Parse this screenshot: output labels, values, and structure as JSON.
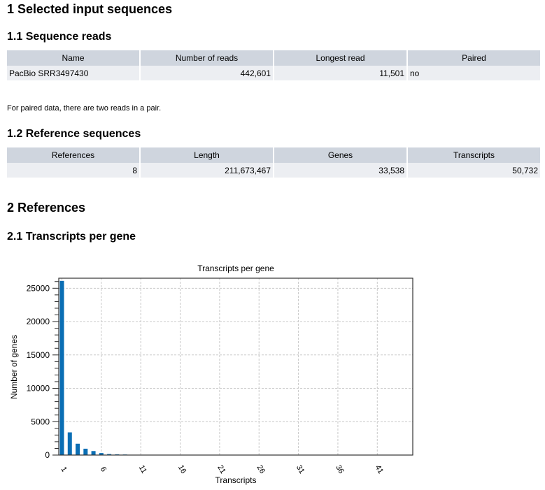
{
  "sections": {
    "s1_title": "1 Selected input sequences",
    "s1_1_title": "1.1 Sequence reads",
    "s1_note": "For paired data, there are two reads in a pair.",
    "s1_2_title": "1.2 Reference sequences",
    "s2_title": "2 References",
    "s2_1_title": "2.1 Transcripts per gene"
  },
  "reads_table": {
    "headers": [
      "Name",
      "Number of reads",
      "Longest read",
      "Paired"
    ],
    "rows": [
      [
        "PacBio SRR3497430",
        "442,601",
        "11,501",
        "no"
      ]
    ]
  },
  "ref_table": {
    "headers": [
      "References",
      "Length",
      "Genes",
      "Transcripts"
    ],
    "rows": [
      [
        "8",
        "211,673,467",
        "33,538",
        "50,732"
      ]
    ]
  },
  "chart_data": {
    "type": "bar",
    "title": "Transcripts per gene",
    "xlabel": "Transcripts",
    "ylabel": "Number of genes",
    "x": [
      1,
      2,
      3,
      4,
      5,
      6,
      7,
      8,
      9
    ],
    "values": [
      26100,
      3400,
      1700,
      950,
      600,
      300,
      150,
      100,
      80
    ],
    "xlim": [
      0.6,
      45.5
    ],
    "ylim": [
      0,
      26500
    ],
    "xticks": [
      1,
      6,
      11,
      16,
      21,
      26,
      31,
      36,
      41
    ],
    "xtick_labels": [
      "1",
      "6",
      "11",
      "16",
      "21",
      "26",
      "31",
      "36",
      "41"
    ],
    "yticks": [
      0,
      5000,
      10000,
      15000,
      20000,
      25000
    ],
    "ytick_labels": [
      "0",
      "5000",
      "10000",
      "15000",
      "20000",
      "25000"
    ],
    "y_minor_step": 1000,
    "grid": true,
    "legend": "none",
    "bar_color": "#0a6eb4"
  }
}
